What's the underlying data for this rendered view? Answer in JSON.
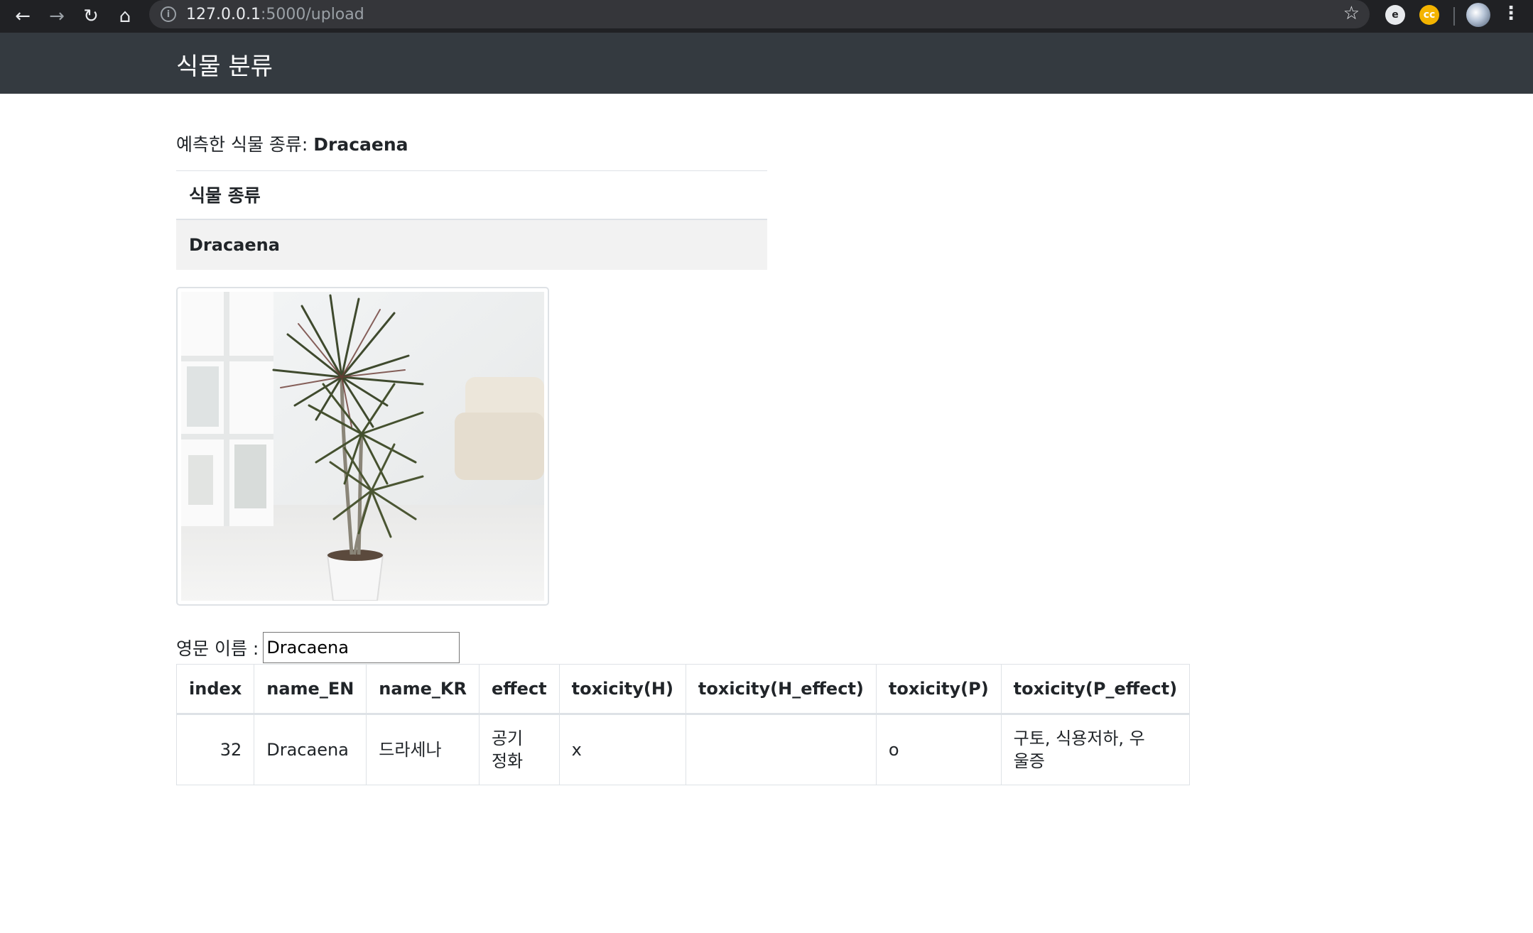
{
  "browser": {
    "url_host": "127.0.0.1",
    "url_rest": ":5000/upload"
  },
  "navbar": {
    "brand": "식물 분류"
  },
  "prediction": {
    "label": "예측한 식물 종류: ",
    "value": "Dracaena"
  },
  "summary": {
    "header": "식물 종류",
    "value": "Dracaena"
  },
  "image": {
    "icon": "dracaena-plant-photo"
  },
  "english_name": {
    "label": "영문 이름 :",
    "value": "Dracaena"
  },
  "table": {
    "headers": [
      "index",
      "name_EN",
      "name_KR",
      "effect",
      "toxicity(H)",
      "toxicity(H_effect)",
      "toxicity(P)",
      "toxicity(P_effect)"
    ],
    "rows": [
      [
        "32",
        "Dracaena",
        "드라세나",
        "공기\n정화",
        "x",
        "",
        "o",
        "구토, 식용저하, 우\n울증"
      ]
    ]
  }
}
